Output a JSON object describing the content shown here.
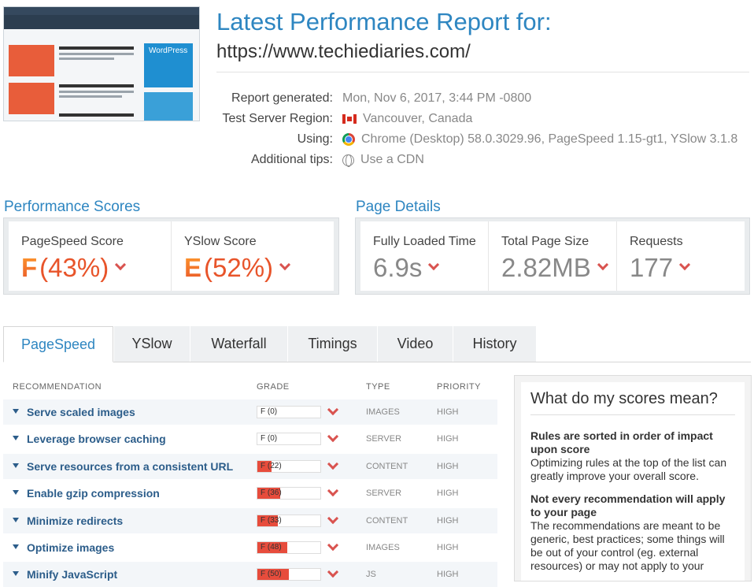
{
  "header": {
    "title": "Latest Performance Report for:",
    "url": "https://www.techiediaries.com/"
  },
  "meta": [
    {
      "label": "Report generated:",
      "value": "Mon, Nov 6, 2017, 3:44 PM -0800",
      "icon": ""
    },
    {
      "label": "Test Server Region:",
      "value": "Vancouver, Canada",
      "icon": "canada-flag-icon"
    },
    {
      "label": "Using:",
      "value": "Chrome (Desktop) 58.0.3029.96, PageSpeed 1.15-gt1, YSlow 3.1.8",
      "icon": "chrome-icon"
    },
    {
      "label": "Additional tips:",
      "value": "Use a CDN",
      "icon": "globe-icon"
    }
  ],
  "performance": {
    "heading": "Performance Scores",
    "pagespeed": {
      "label": "PageSpeed Score",
      "grade": "F",
      "percent": "(43%)"
    },
    "yslow": {
      "label": "YSlow Score",
      "grade": "E",
      "percent": "(52%)"
    }
  },
  "details": {
    "heading": "Page Details",
    "load_time": {
      "label": "Fully Loaded Time",
      "value": "6.9s"
    },
    "page_size": {
      "label": "Total Page Size",
      "value": "2.82MB"
    },
    "requests": {
      "label": "Requests",
      "value": "177"
    }
  },
  "tabs": [
    "PageSpeed",
    "YSlow",
    "Waterfall",
    "Timings",
    "Video",
    "History"
  ],
  "table": {
    "headers": {
      "recommendation": "RECOMMENDATION",
      "grade": "GRADE",
      "type": "TYPE",
      "priority": "PRIORITY"
    },
    "rows": [
      {
        "name": "Serve scaled images",
        "grade": "F (0)",
        "score": 0,
        "type": "IMAGES",
        "priority": "HIGH"
      },
      {
        "name": "Leverage browser caching",
        "grade": "F (0)",
        "score": 0,
        "type": "SERVER",
        "priority": "HIGH"
      },
      {
        "name": "Serve resources from a consistent URL",
        "grade": "F (22)",
        "score": 22,
        "type": "CONTENT",
        "priority": "HIGH"
      },
      {
        "name": "Enable gzip compression",
        "grade": "F (36)",
        "score": 36,
        "type": "SERVER",
        "priority": "HIGH"
      },
      {
        "name": "Minimize redirects",
        "grade": "F (33)",
        "score": 33,
        "type": "CONTENT",
        "priority": "HIGH"
      },
      {
        "name": "Optimize images",
        "grade": "F (48)",
        "score": 48,
        "type": "IMAGES",
        "priority": "HIGH"
      },
      {
        "name": "Minify JavaScript",
        "grade": "F (50)",
        "score": 50,
        "type": "JS",
        "priority": "HIGH"
      }
    ]
  },
  "sidebar": {
    "title": "What do my scores mean?",
    "p1_bold": "Rules are sorted in order of impact upon score",
    "p1_text": "Optimizing rules at the top of the list can greatly improve your overall score.",
    "p2_bold": "Not every recommendation will apply to your page",
    "p2_text": "The recommendations are meant to be generic, best practices; some things will be out of your control (eg. external resources) or may not apply to your"
  },
  "thumbnail": {
    "ad_text": "WordPress"
  },
  "colors": {
    "accent": "#2e86c1",
    "grade_red": "#e8542a",
    "bar_red": "#e74c3c"
  }
}
